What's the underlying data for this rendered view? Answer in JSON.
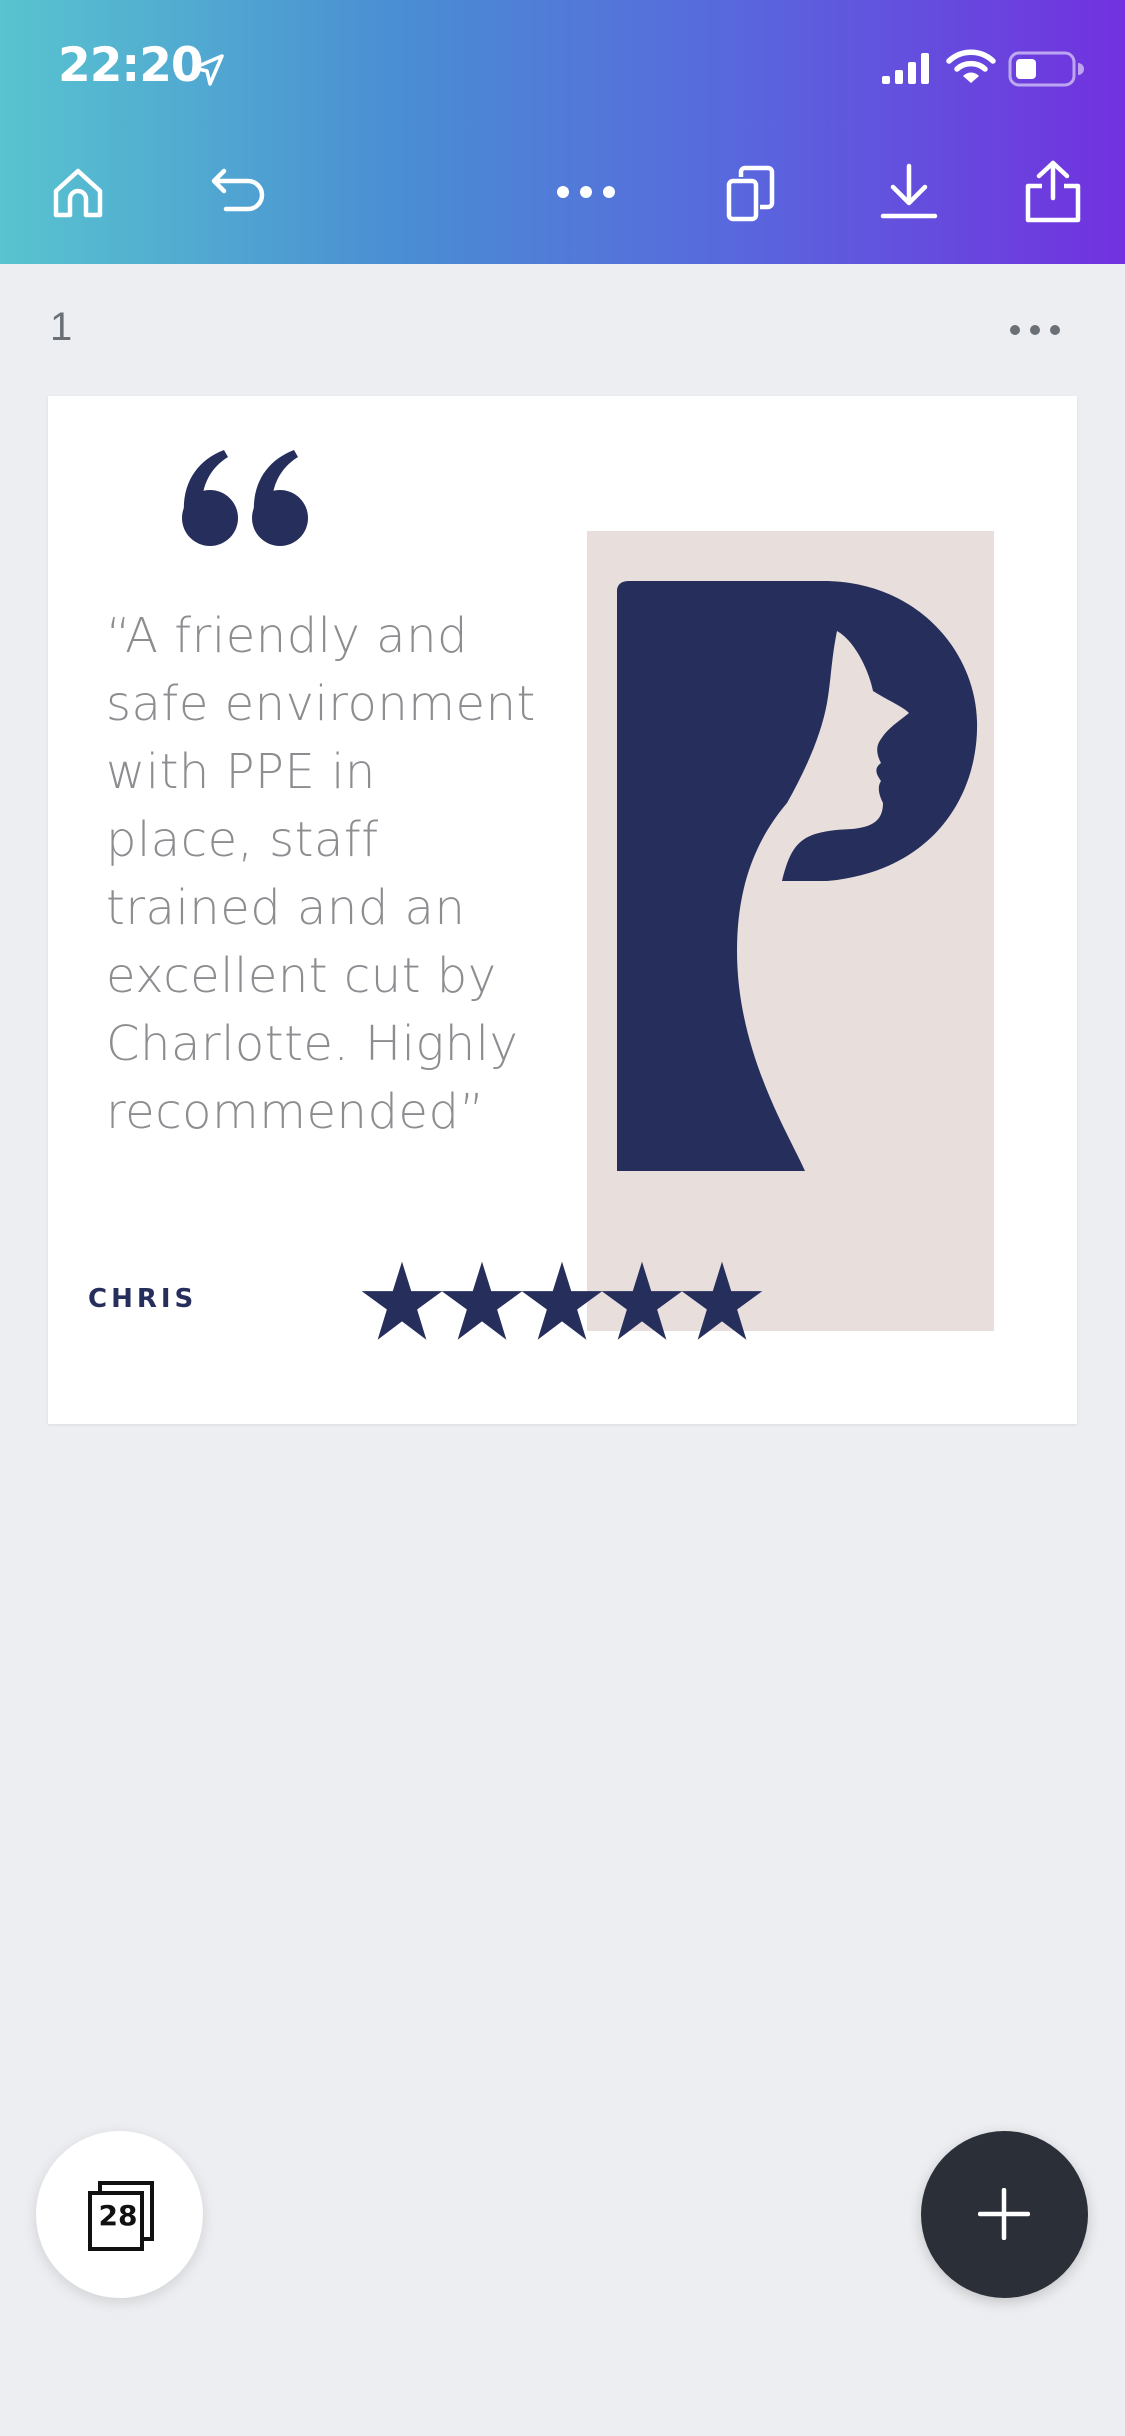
{
  "status_bar": {
    "time": "22:20",
    "icons": [
      "location-arrow-icon",
      "signal-bars-icon",
      "wifi-icon",
      "battery-icon"
    ]
  },
  "toolbar": {
    "icons": [
      "home-icon",
      "undo-icon",
      "more-horizontal-icon",
      "copy-pages-icon",
      "download-icon",
      "share-icon"
    ]
  },
  "page": {
    "number": "1",
    "more_icon": "more-horizontal-icon"
  },
  "card": {
    "quote_mark_icon": "quote-mark-icon",
    "quote": "“A friendly and safe environment with PPE in place, staff trained and an excellent cut by Charlotte. Highly recommended”",
    "author": "CHRIS",
    "rating": 5,
    "rating_max": 5
  },
  "fabs": {
    "pages_count": "28",
    "pages_icon": "pages-stack-icon",
    "add_icon": "plus-icon"
  },
  "colors": {
    "navy": "#262e5c",
    "portrait_bg": "#e8dedb",
    "header_gradient_start": "#58c4cf",
    "header_gradient_end": "#7231df"
  }
}
